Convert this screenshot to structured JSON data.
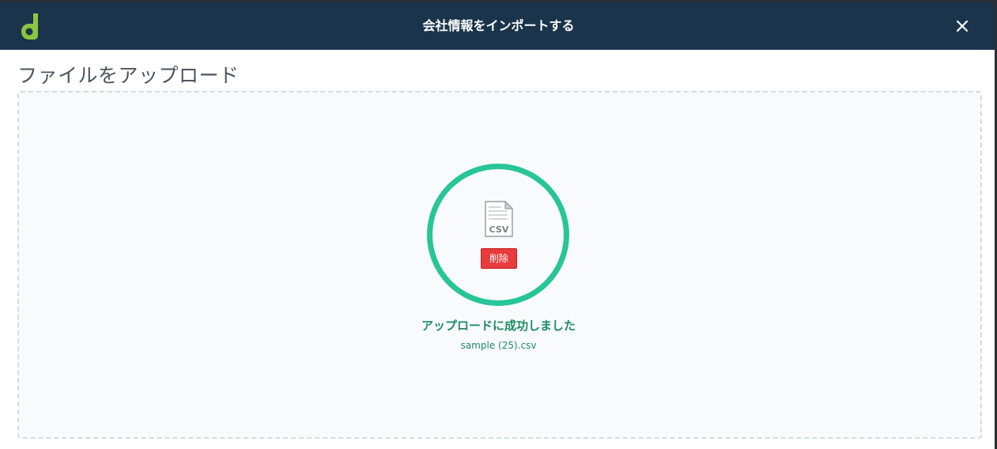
{
  "header": {
    "title": "会社情報をインポートする",
    "logo_icon": "leaf-d-logo-icon",
    "close_icon": "close-icon",
    "background": "#1a344c",
    "logo_color": "#8cc63f"
  },
  "upload": {
    "section_title": "ファイルをアップロード",
    "file_icon": "csv-file-icon",
    "file_type_label": "CSV",
    "delete_label": "削除",
    "success_message": "アップロードに成功しました",
    "file_name": "sample (25).csv",
    "ring_color": "#27c597",
    "success_color": "#1e8b63",
    "delete_color": "#e83b3b"
  }
}
